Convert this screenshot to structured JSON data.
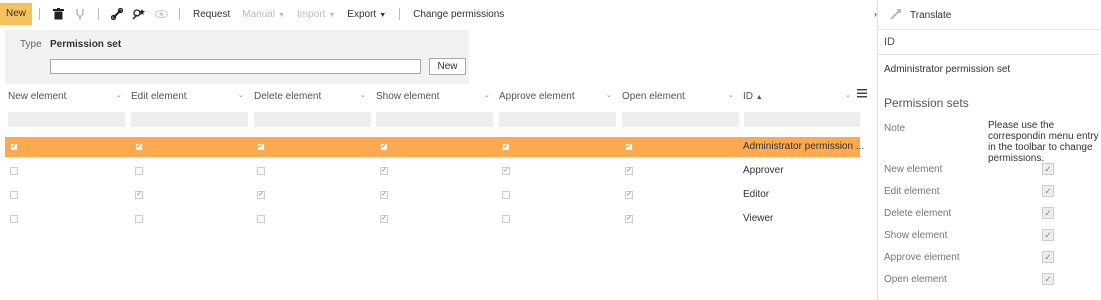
{
  "toolbar": {
    "new_label": "New",
    "request_label": "Request",
    "manual_label": "Manual",
    "import_label": "Import",
    "export_label": "Export",
    "change_permissions_label": "Change permissions"
  },
  "type_panel": {
    "type_label": "Type",
    "permission_set_label": "Permission set",
    "input_value": "",
    "new_button_label": "New"
  },
  "grid": {
    "columns": [
      "New element",
      "Edit element",
      "Delete element",
      "Show element",
      "Approve element",
      "Open element",
      "ID"
    ],
    "sort_indicator": "▲",
    "rows": [
      {
        "id": "Administrator permission ...",
        "checks": [
          true,
          true,
          true,
          true,
          true,
          true
        ],
        "selected": true
      },
      {
        "id": "Approver",
        "checks": [
          false,
          false,
          false,
          true,
          true,
          true
        ],
        "selected": false
      },
      {
        "id": "Editor",
        "checks": [
          false,
          true,
          true,
          true,
          false,
          true
        ],
        "selected": false
      },
      {
        "id": "Viewer",
        "checks": [
          false,
          false,
          false,
          true,
          false,
          true
        ],
        "selected": false
      }
    ]
  },
  "right_panel": {
    "translate_label": "Translate",
    "id_label": "ID",
    "id_value": "Administrator permission set",
    "permission_sets_label": "Permission sets",
    "note_label": "Note",
    "note_text": "Please use the correspondin menu entry in the toolbar to change permissions.",
    "fields": [
      {
        "label": "New element",
        "checked": true
      },
      {
        "label": "Edit element",
        "checked": true
      },
      {
        "label": "Delete element",
        "checked": true
      },
      {
        "label": "Show element",
        "checked": true
      },
      {
        "label": "Approve element",
        "checked": true
      },
      {
        "label": "Open element",
        "checked": true
      }
    ]
  },
  "colors": {
    "accent": "#f8c25a",
    "selected_row": "#fca94f"
  }
}
